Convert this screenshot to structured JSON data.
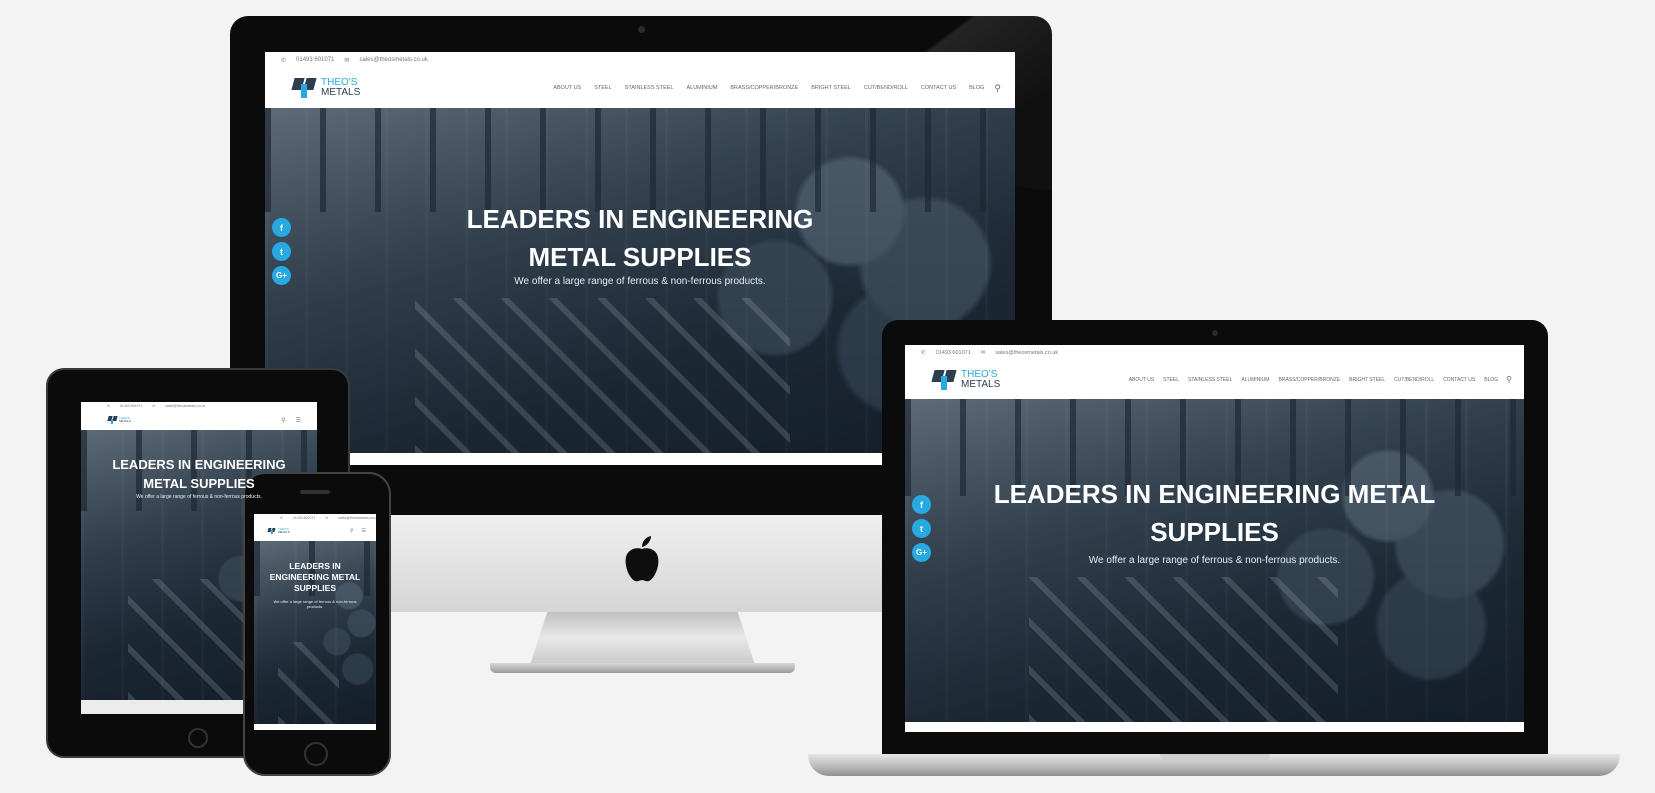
{
  "site": {
    "phone": "01493 601071",
    "email": "sales@theosmetals.co.uk",
    "logo_line1": "THEO'S",
    "logo_line2": "METALS",
    "nav": [
      "ABOUT US",
      "STEEL",
      "STAINLESS STEEL",
      "ALUMINIUM",
      "BRASS/COPPER/BRONZE",
      "BRIGHT STEEL",
      "CUT/BEND/ROLL",
      "CONTACT US",
      "BLOG"
    ],
    "hero_title": "LEADERS IN ENGINEERING METAL SUPPLIES",
    "hero_subtitle": "We offer a large range of ferrous & non-ferrous products.",
    "social": [
      "f",
      "t",
      "G+"
    ]
  },
  "icons": {
    "phone": "phone-icon",
    "email": "envelope-icon",
    "search": "search-icon",
    "apple": "apple-logo-icon",
    "menu": "hamburger-menu-icon"
  },
  "colors": {
    "accent": "#27a9e1",
    "logo_dark": "#2c3e50",
    "device_frame": "#0b0b0b",
    "background": "#f3f3f3"
  }
}
